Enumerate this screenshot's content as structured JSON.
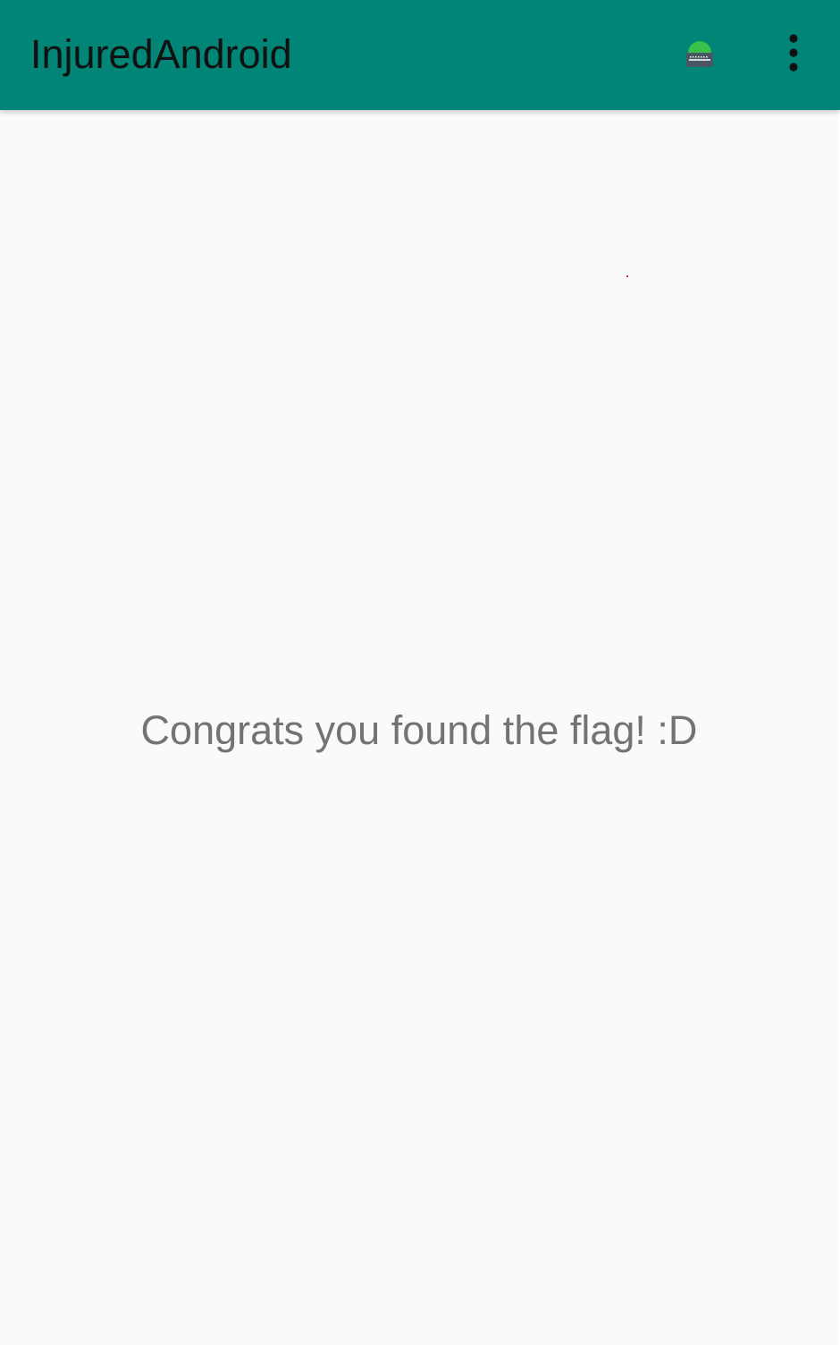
{
  "app_bar": {
    "title": "InjuredAndroid",
    "background_color": "#008577",
    "actions": [
      {
        "icon": "hacker-badge-icon"
      },
      {
        "icon": "more-vert-icon"
      }
    ]
  },
  "content": {
    "message": "Congrats you found the flag! :D",
    "message_color": "#737373",
    "background_color": "#fafafa"
  }
}
